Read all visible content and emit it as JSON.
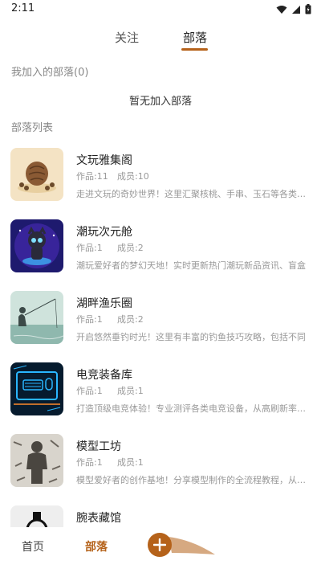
{
  "status": {
    "time": "2:11"
  },
  "tabs": [
    {
      "label": "关注"
    },
    {
      "label": "部落"
    }
  ],
  "joined": {
    "title": "我加入的部落(0)",
    "empty": "暂无加入部落"
  },
  "list": {
    "title": "部落列表"
  },
  "tribes": [
    {
      "name": "文玩雅集阁",
      "works": "作品:11",
      "members": "成员:10",
      "desc": "走进文玩的奇妙世界！这里汇聚核桃、手串、玉石等各类文玩"
    },
    {
      "name": "潮玩次元舱",
      "works": "作品:1",
      "members": "成员:2",
      "desc": "潮玩爱好者的梦幻天地！实时更新热门潮玩新品资讯、盲盒"
    },
    {
      "name": "湖畔渔乐圈",
      "works": "作品:1",
      "members": "成员:2",
      "desc": "开启悠然垂钓时光！这里有丰富的钓鱼技巧攻略，包括不同"
    },
    {
      "name": "电竞装备库",
      "works": "作品:1",
      "members": "成员:1",
      "desc": "打造顶级电竞体验！专业测评各类电竞设备，从高刷新率显示"
    },
    {
      "name": "模型工坊",
      "works": "作品:1",
      "members": "成员:1",
      "desc": "模型爱好者的创作基地！分享模型制作的全流程教程，从素材"
    },
    {
      "name": "腕表藏馆",
      "works": "",
      "members": "",
      "desc": ""
    }
  ],
  "bottom_nav": {
    "home": "首页",
    "tribe": "部落"
  },
  "colors": {
    "accent": "#b5621a",
    "muted": "#999999"
  },
  "icons": [
    "wifi-icon",
    "signal-icon",
    "battery-icon",
    "plus-icon"
  ]
}
